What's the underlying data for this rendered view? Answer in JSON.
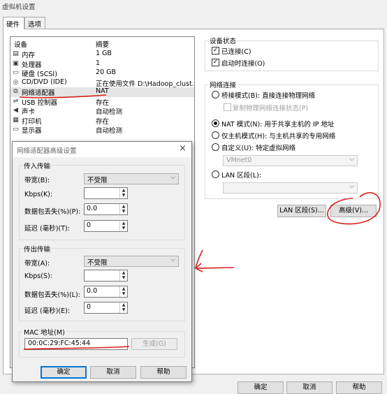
{
  "window": {
    "title": "虚拟机设置"
  },
  "tabs": [
    {
      "label": "硬件"
    },
    {
      "label": "选项"
    }
  ],
  "devices": {
    "header_device": "设备",
    "header_summary": "摘要",
    "rows": [
      {
        "icon": "memory-icon",
        "glyph": "▤",
        "name": "内存",
        "summary": "1 GB"
      },
      {
        "icon": "processor-icon",
        "glyph": "▣",
        "name": "处理器",
        "summary": "1"
      },
      {
        "icon": "disk-icon",
        "glyph": "▭",
        "name": "硬盘 (SCSI)",
        "summary": "20 GB"
      },
      {
        "icon": "cd-icon",
        "glyph": "◎",
        "name": "CD/DVD (IDE)",
        "summary": "正在使用文件 D:\\Hadoop_clust..."
      },
      {
        "icon": "network-adapter-icon",
        "glyph": "⧉",
        "name": "网络适配器",
        "summary": "NAT"
      },
      {
        "icon": "usb-icon",
        "glyph": "⇌",
        "name": "USB 控制器",
        "summary": "存在"
      },
      {
        "icon": "sound-icon",
        "glyph": "◀",
        "name": "声卡",
        "summary": "自动检测"
      },
      {
        "icon": "printer-icon",
        "glyph": "▦",
        "name": "打印机",
        "summary": "存在"
      },
      {
        "icon": "display-icon",
        "glyph": "▭",
        "name": "显示器",
        "summary": "自动检测"
      }
    ]
  },
  "device_status": {
    "title": "设备状态",
    "connected": "已连接(C)",
    "connect_on_power": "启动时连接(O)"
  },
  "network_connection": {
    "title": "网络连接",
    "bridged": "桥接模式(B): 直接连接物理网络",
    "replicate": "复制物理网络连接状态(P)",
    "nat": "NAT 模式(N): 用于共享主机的 IP 地址",
    "host_only": "仅主机模式(H): 与主机共享的专用网络",
    "custom": "自定义(U): 特定虚拟网络",
    "custom_value": "VMnet0",
    "lan": "LAN 区段(L):",
    "lan_value": ""
  },
  "right_buttons": {
    "lan_segment": "LAN 区段(S)...",
    "advanced": "高级(V)..."
  },
  "main_buttons": {
    "ok": "确定",
    "cancel": "取消",
    "help": "帮助"
  },
  "dialog": {
    "title": "网络适配器高级设置",
    "incoming": {
      "title": "传入传输",
      "bandwidth_label": "带宽(B):",
      "bandwidth_value": "不受限",
      "kbps_label": "Kbps(K):",
      "kbps_value": "",
      "loss_label": "数据包丢失(%)(P):",
      "loss_value": "0.0",
      "latency_label": "延迟 (毫秒)(T):",
      "latency_value": "0"
    },
    "outgoing": {
      "title": "传出传输",
      "bandwidth_label": "带宽(A):",
      "bandwidth_value": "不受限",
      "kbps_label": "Kbps(S):",
      "kbps_value": "",
      "loss_label": "数据包丢失(%)(L):",
      "loss_value": "0.0",
      "latency_label": "延迟 (毫秒)(E):",
      "latency_value": "0"
    },
    "mac": {
      "title": "MAC 地址(M)",
      "value": "00:0C:29:FC:45:44",
      "generate": "生成(G)"
    },
    "buttons": {
      "ok": "确定",
      "cancel": "取消",
      "help": "帮助"
    }
  },
  "colors": {
    "annotation": "#d8221c",
    "accent": "#0078d7"
  }
}
